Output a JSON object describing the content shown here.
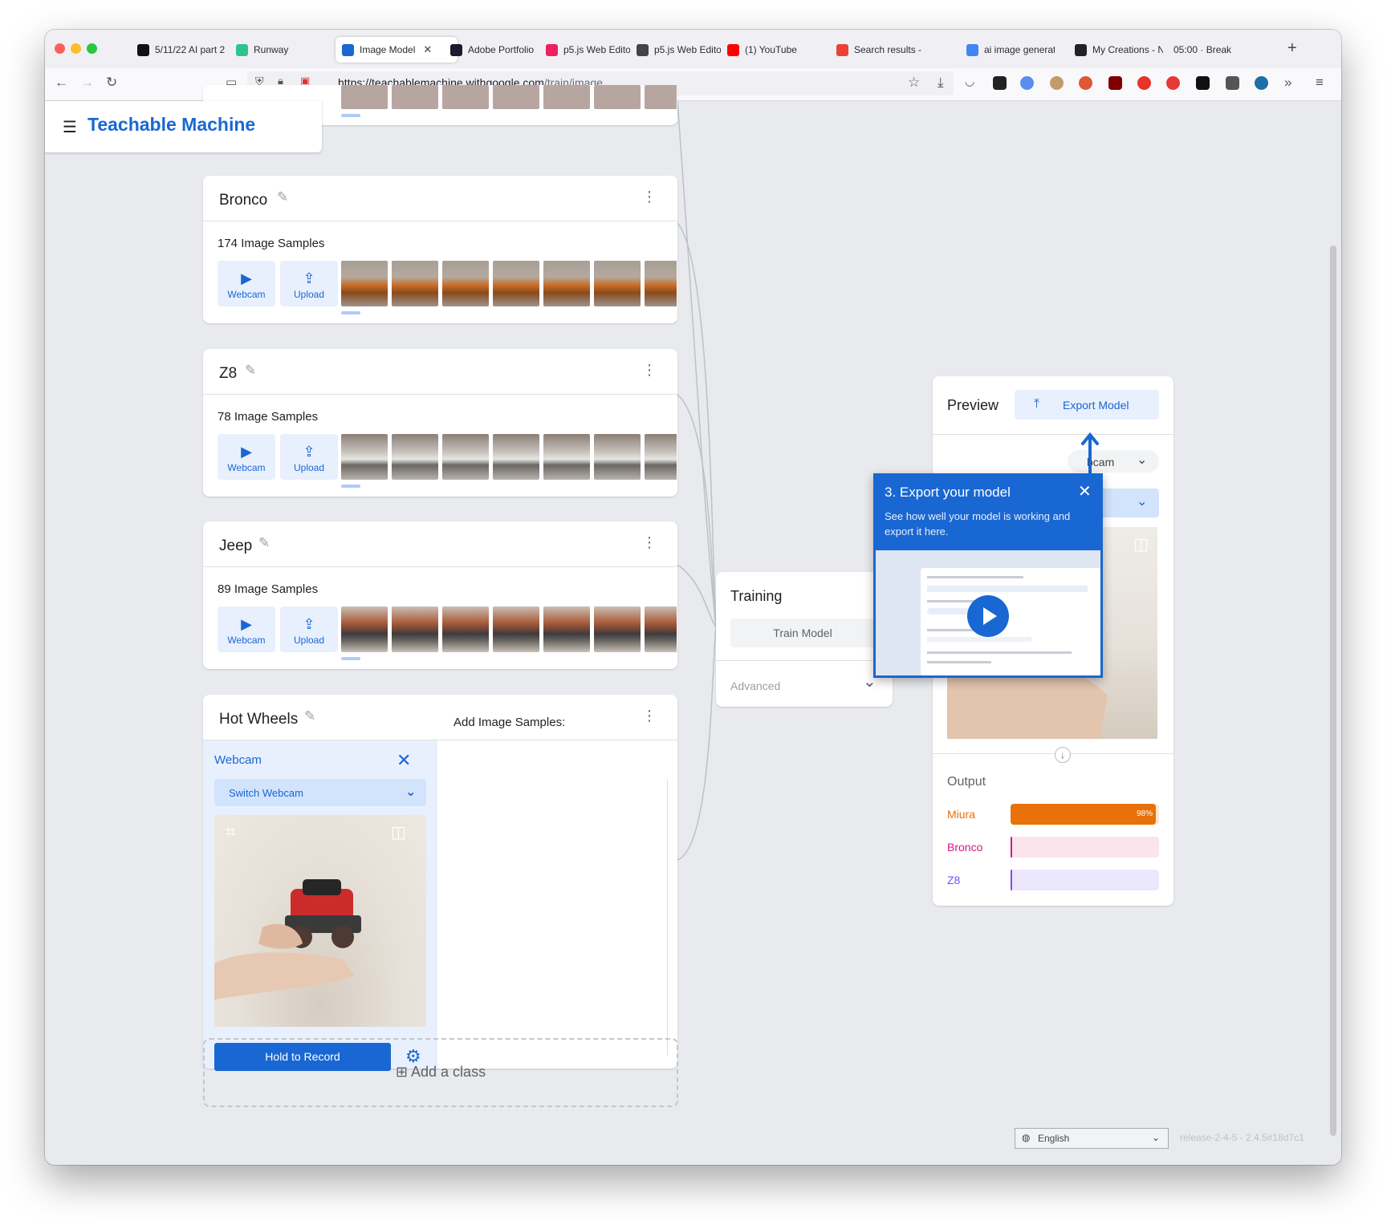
{
  "browser": {
    "tabs": [
      {
        "label": "5/11/22 AI part 2",
        "icon": "notion-icon",
        "color": "#111111"
      },
      {
        "label": "Runway",
        "icon": "runway-icon",
        "color": "#2fc48d"
      },
      {
        "label": "Image Model",
        "icon": "teachable-machine-icon",
        "color": "#1967d2",
        "active": true
      },
      {
        "label": "Adobe Portfolio",
        "icon": "adobe-portfolio-icon",
        "color": "#1b1b2e"
      },
      {
        "label": "p5.js Web Editor",
        "icon": "p5-icon",
        "color": "#ed225d"
      },
      {
        "label": "p5.js Web Editor",
        "icon": "globe-icon",
        "color": "#444444"
      },
      {
        "label": "(1) YouTube",
        "icon": "youtube-icon",
        "color": "#ff0000"
      },
      {
        "label": "Search results -",
        "icon": "gmail-icon",
        "color": "#ea4335"
      },
      {
        "label": "ai image generat",
        "icon": "google-icon",
        "color": "#4285f4"
      },
      {
        "label": "My Creations - N",
        "icon": "nightcafe-icon",
        "color": "#222222"
      },
      {
        "label": "05:00 · Break",
        "icon": "",
        "color": "#ffffff"
      }
    ],
    "active_tab_close": "✕",
    "new_tab": "+",
    "url_host": "https://teachablemachine.withgoogle.com",
    "url_path": "/train/image"
  },
  "app": {
    "brand": "Teachable Machine",
    "menu_icon": "☰"
  },
  "classes": [
    {
      "name": "Bronco",
      "samples": "174 Image Samples",
      "thumb_style": "orange"
    },
    {
      "name": "Z8",
      "samples": "78 Image Samples",
      "thumb_style": "white"
    },
    {
      "name": "Jeep",
      "samples": "89 Image Samples",
      "thumb_style": "dark"
    }
  ],
  "sample_buttons": {
    "webcam": "Webcam",
    "upload": "Upload"
  },
  "hot_wheels": {
    "name": "Hot Wheels",
    "webcam_label": "Webcam",
    "switch_webcam": "Switch Webcam",
    "hold_to_record": "Hold to Record",
    "add_image_samples": "Add Image Samples:"
  },
  "add_class": "Add a class",
  "training": {
    "title": "Training",
    "train_button": "Train Model",
    "advanced": "Advanced"
  },
  "preview": {
    "title": "Preview",
    "export_button": "Export Model",
    "webcam_partial": "bcam",
    "output_title": "Output",
    "outputs": [
      {
        "label": "Miura",
        "value": 0.98,
        "pct": "98%",
        "color": "#e8710a",
        "bg": "#fce8d6"
      },
      {
        "label": "Bronco",
        "value": 0.01,
        "pct": "",
        "color": "#d01884",
        "bg": "#fce4ec"
      },
      {
        "label": "Z8",
        "value": 0.01,
        "pct": "",
        "color": "#7c4dff",
        "bg": "#ede7fd"
      }
    ]
  },
  "tooltip": {
    "title": "3. Export your model",
    "body": "See how well your model is working and export it here.",
    "close": "✕"
  },
  "footer": {
    "language": "English",
    "release": "release-2-4-5 - 2.4.5#18d7c1"
  }
}
